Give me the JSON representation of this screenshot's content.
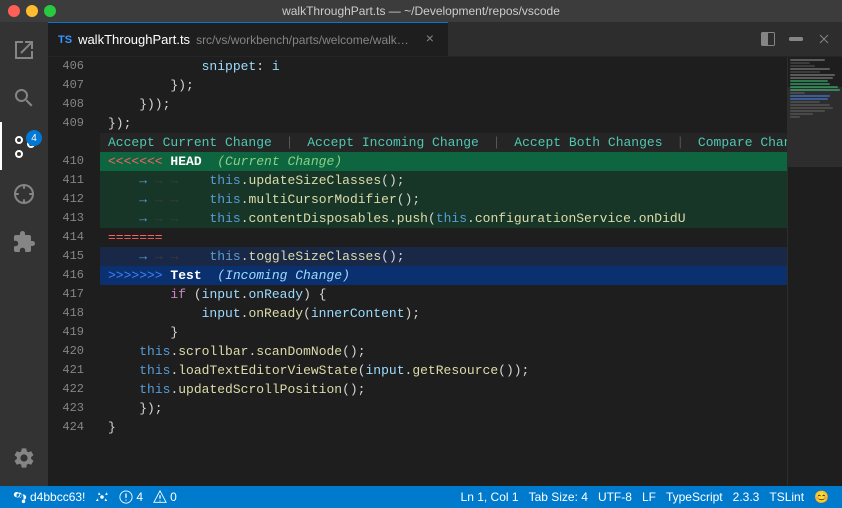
{
  "titleBar": {
    "title": "walkThroughPart.ts — ~/Development/repos/vscode"
  },
  "tabBar": {
    "badge": "TS",
    "filename": "walkThroughPart.ts",
    "path": "src/vs/workbench/parts/welcome/walkThrough/electron-browser"
  },
  "conflictActions": {
    "acceptCurrent": "Accept Current Change",
    "sep1": "|",
    "acceptIncoming": "Accept Incoming Change",
    "sep2": "|",
    "acceptBoth": "Accept Both Changes",
    "sep3": "|",
    "compare": "Compare Changes"
  },
  "lines": [
    {
      "num": "406",
      "content": "            snippet: i",
      "type": "normal"
    },
    {
      "num": "407",
      "content": "        });",
      "type": "normal"
    },
    {
      "num": "408",
      "content": "    }));",
      "type": "normal"
    },
    {
      "num": "409",
      "content": "});",
      "type": "normal"
    },
    {
      "num": "",
      "content": "",
      "type": "conflict-actions"
    },
    {
      "num": "410",
      "content": "<<<<<<< HEAD  (Current Change)",
      "type": "conflict-header-current"
    },
    {
      "num": "411",
      "content": "    this.updateSizeClasses();",
      "type": "current-change"
    },
    {
      "num": "412",
      "content": "    this.multiCursorModifier();",
      "type": "current-change"
    },
    {
      "num": "413",
      "content": "    this.contentDisposables.push(this.configurationService.onDidU",
      "type": "current-change"
    },
    {
      "num": "414",
      "content": "=======",
      "type": "conflict-separator"
    },
    {
      "num": "415",
      "content": "    this.toggleSizeClasses();",
      "type": "incoming-change"
    },
    {
      "num": "416",
      "content": ">>>>>>> Test  (Incoming Change)",
      "type": "conflict-header-incoming"
    },
    {
      "num": "417",
      "content": "        if (input.onReady) {",
      "type": "normal"
    },
    {
      "num": "418",
      "content": "            input.onReady(innerContent);",
      "type": "normal"
    },
    {
      "num": "419",
      "content": "        }",
      "type": "normal"
    },
    {
      "num": "420",
      "content": "    this.scrollbar.scanDomNode();",
      "type": "normal"
    },
    {
      "num": "421",
      "content": "    this.loadTextEditorViewState(input.getResource());",
      "type": "normal"
    },
    {
      "num": "422",
      "content": "    this.updatedScrollPosition();",
      "type": "normal"
    },
    {
      "num": "423",
      "content": "    });",
      "type": "normal"
    },
    {
      "num": "424",
      "content": "}",
      "type": "normal"
    }
  ],
  "statusBar": {
    "branch": "d4bbcc63!",
    "sync": "",
    "errors": "4",
    "warnings": "0",
    "position": "Ln 1, Col 1",
    "tabSize": "Tab Size: 4",
    "encoding": "UTF-8",
    "lineEnding": "LF",
    "language": "TypeScript",
    "version": "2.3.3",
    "linter": "TSLint",
    "smile": "😊"
  }
}
